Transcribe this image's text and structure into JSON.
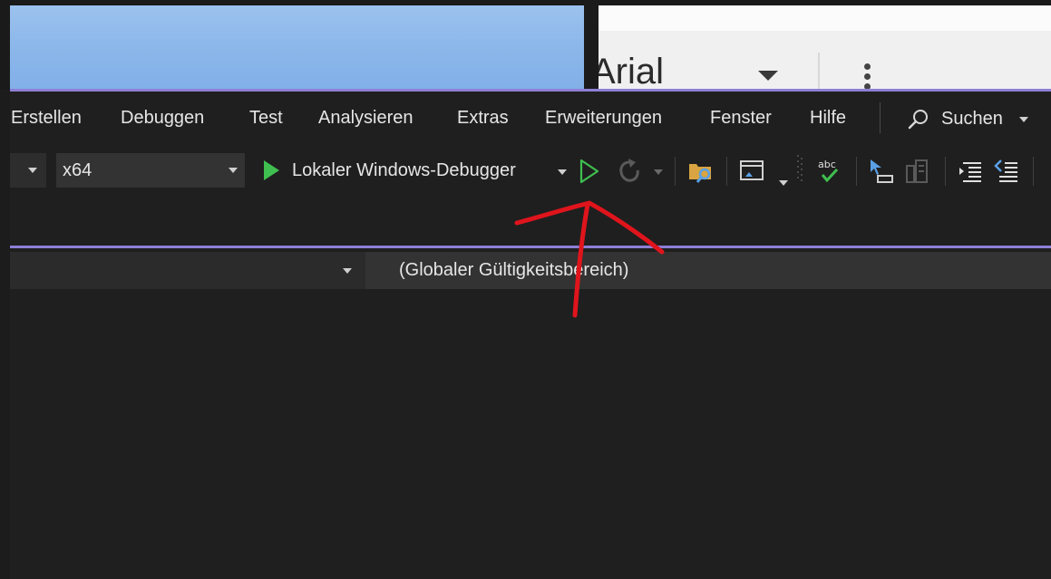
{
  "background_window": {
    "font_name": "Arial"
  },
  "menu": {
    "items": [
      {
        "label": "Erstellen"
      },
      {
        "label": "Debuggen"
      },
      {
        "label": "Test"
      },
      {
        "label": "Analysieren"
      },
      {
        "label": "Extras"
      },
      {
        "label": "Erweiterungen"
      },
      {
        "label": "Fenster"
      },
      {
        "label": "Hilfe"
      }
    ],
    "search_label": "Suchen"
  },
  "toolbar": {
    "platform": "x64",
    "debug_target": "Lokaler Windows-Debugger",
    "icons": [
      "solution-explorer-icon",
      "window-layout-icon",
      "spell-check-icon",
      "breakpoint-icon",
      "parallel-stacks-icon",
      "indent-icon",
      "comment-lines-icon"
    ]
  },
  "navigation_bar": {
    "scope": "(Globaler Gültigkeitsbereich)"
  },
  "colors": {
    "accent": "#8e7fd6",
    "run_green": "#3fbf4f",
    "annotation_red": "#e0141c",
    "vs_background": "#1f1f1f"
  }
}
